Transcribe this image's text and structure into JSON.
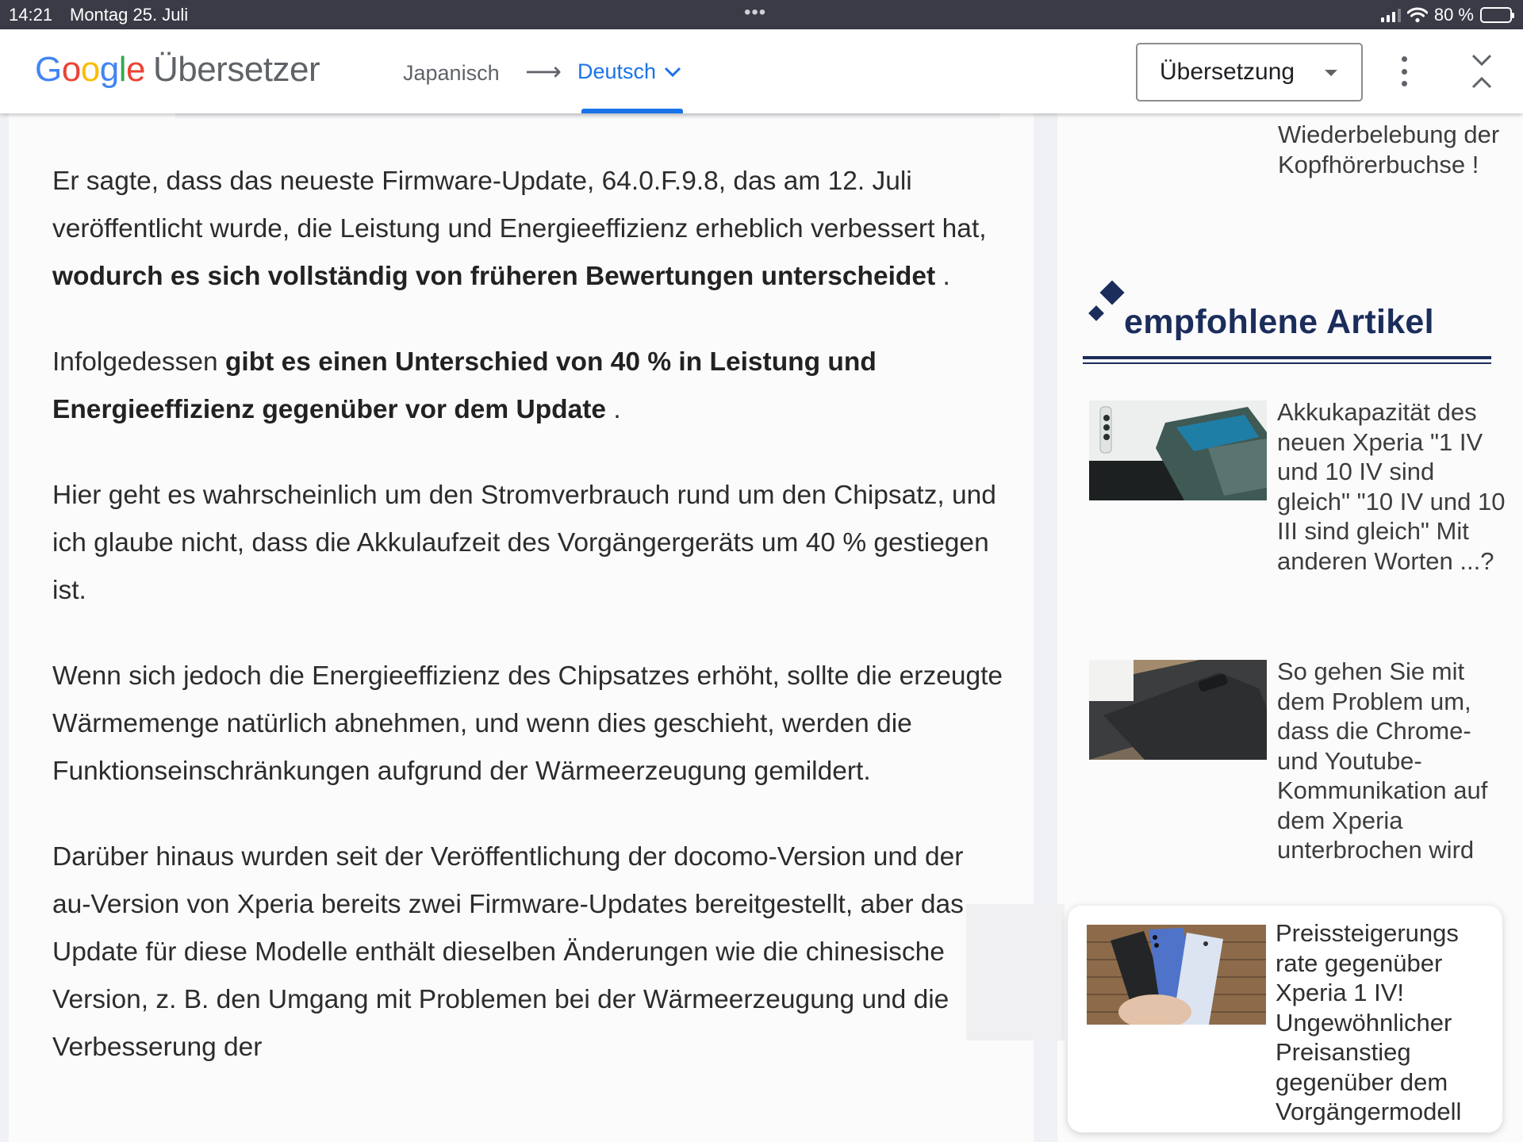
{
  "status_bar": {
    "time": "14:21",
    "date": "Montag 25. Juli",
    "battery": "80 %",
    "battery_level": 0.8
  },
  "translate_bar": {
    "logo_letters": [
      "G",
      "o",
      "o",
      "g",
      "l",
      "e"
    ],
    "product": "Übersetzer",
    "source_language": "Japanisch",
    "target_language": "Deutsch",
    "mode": "Übersetzung",
    "colors": {
      "accent": "#1a73e8",
      "text": "#5f6368"
    }
  },
  "article": {
    "paragraphs": [
      {
        "segments": [
          {
            "text": "Er sagte, dass das neueste Firmware-Update, 64.0.F.9.8, das am 12. Juli veröffentlicht wurde, die Leistung und Energieeffizienz erheblich verbessert hat, ",
            "bold": false
          },
          {
            "text": "wodurch es sich vollständig von früheren Bewertungen unterscheidet",
            "bold": true
          },
          {
            "text": " .",
            "bold": false
          }
        ]
      },
      {
        "segments": [
          {
            "text": "Infolgedessen ",
            "bold": false
          },
          {
            "text": "gibt es einen Unterschied von 40 % in Leistung und Energieeffizienz gegenüber vor dem Update",
            "bold": true
          },
          {
            "text": " .",
            "bold": false
          }
        ]
      },
      {
        "segments": [
          {
            "text": "Hier geht es wahrscheinlich um den Stromverbrauch rund um den Chipsatz, und ich glaube nicht, dass die Akkulaufzeit des Vorgängergeräts um 40 % gestiegen ist.",
            "bold": false
          }
        ]
      },
      {
        "segments": [
          {
            "text": "Wenn sich jedoch die Energieeffizienz des Chipsatzes erhöht, sollte die erzeugte Wärmemenge natürlich abnehmen, und wenn dies geschieht, werden die Funktionseinschränkungen aufgrund der Wärmeerzeugung gemildert.",
            "bold": false
          }
        ]
      },
      {
        "segments": [
          {
            "text": "Darüber hinaus wurden seit der Veröffentlichung der docomo-Version und der au-Version von Xperia bereits zwei Firmware-Updates bereitgestellt, aber das Update für diese Modelle enthält dieselben Änderungen wie die chinesische Version, z. B. den Umgang mit Problemen bei der Wärmeerzeugung und die Verbesserung der",
            "bold": false
          }
        ]
      }
    ]
  },
  "sidebar": {
    "prev_item_tail": "Wiederbelebung der Kopfhörerbuchse !",
    "section_title": "empfohlene Artikel",
    "accent_color": "#1b2d5b",
    "articles": [
      {
        "title": "Akkukapazität des neuen Xperia \"1 IV und 10 IV sind gleich\" \"10 IV und 10 III sind gleich\" Mit anderen Worten ...?"
      },
      {
        "title": "So gehen Sie mit dem Problem um, dass die Chrome- und Youtube-Kommunikation auf dem Xperia unterbrochen wird"
      }
    ],
    "floating_card": {
      "title": "Preissteigerungs rate gegenüber Xperia 1 IV! Ungewöhnlicher Preisanstieg gegenüber dem Vorgängermodell"
    }
  }
}
